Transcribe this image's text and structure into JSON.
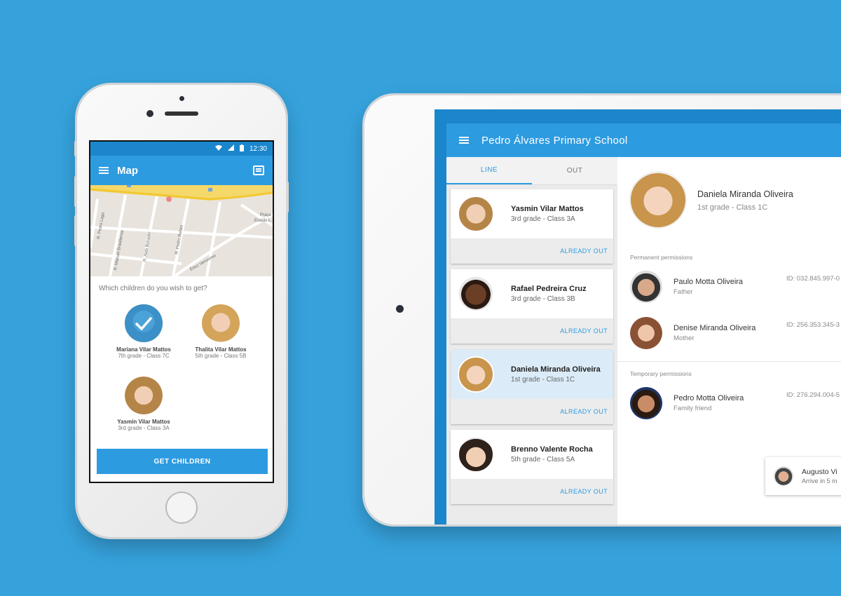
{
  "phone": {
    "status_time": "12:30",
    "title": "Map",
    "map_labels": {
      "street1": "R. Pedro Lago",
      "street2": "R. Manuel Brasiliense",
      "street3": "R. Aldo Bonadei",
      "street4": "R. Pedro Bolato",
      "street5": "Érico Veríssimo",
      "place1": "Praça",
      "place2": "Evaldo L."
    },
    "question": "Which children do you wish to get?",
    "children": [
      {
        "name": "Mariana Vilar Mattos",
        "grade": "7th grade - Class 7C",
        "selected": true
      },
      {
        "name": "Thalita Vilar Mattos",
        "grade": "5th grade - Class 5B",
        "selected": false
      },
      {
        "name": "Yasmin Vilar Mattos",
        "grade": "3rd grade - Class 3A",
        "selected": false
      }
    ],
    "button_label": "GET CHILDREN"
  },
  "tablet": {
    "title": "Pedro Álvares Primary School",
    "tabs": [
      "LINE",
      "OUT"
    ],
    "active_tab": "LINE",
    "students": [
      {
        "name": "Yasmin Vilar Mattos",
        "grade": "3rd grade - Class 3A",
        "action": "ALREADY OUT"
      },
      {
        "name": "Rafael Pedreira Cruz",
        "grade": "3rd grade - Class 3B",
        "action": "ALREADY OUT"
      },
      {
        "name": "Daniela Miranda Oliveira",
        "grade": "1st grade - Class 1C",
        "action": "ALREADY OUT"
      },
      {
        "name": "Brenno Valente Rocha",
        "grade": "5th grade - Class 5A",
        "action": "ALREADY OUT"
      }
    ],
    "selected_student": {
      "name": "Daniela Miranda Oliveira",
      "grade": "1st grade - Class 1C"
    },
    "permanent_label": "Permanent permissions",
    "permanent": [
      {
        "name": "Paulo Motta Oliveira",
        "relation": "Father",
        "id": "ID: 032.845.997-0"
      },
      {
        "name": "Denise Miranda Oliveira",
        "relation": "Mother",
        "id": "ID: 256.353.345-3"
      }
    ],
    "temporary_label": "Temporary permissions",
    "temporary": [
      {
        "name": "Pedro Motta Oliveira",
        "relation": "Family friend",
        "id": "ID: 276.294.004-5"
      }
    ],
    "toast": {
      "name": "Augusto Vi",
      "subtitle": "Arrive in 5 m"
    }
  },
  "colors": {
    "background": "#36a2dc",
    "primary": "#2d9be0",
    "primary_dark": "#1b86cc",
    "selected_row": "#dbebf7"
  }
}
